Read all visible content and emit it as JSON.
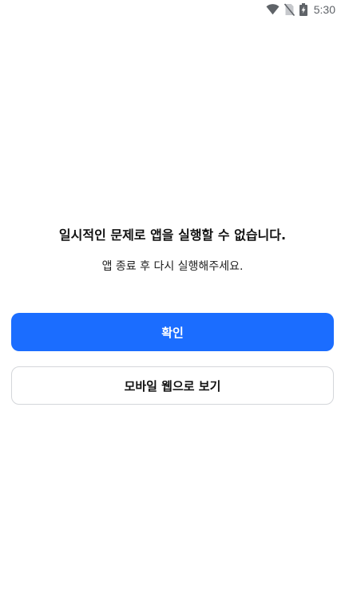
{
  "status_bar": {
    "time": "5:30",
    "icons": [
      "wifi-icon",
      "no-sim-icon",
      "battery-charging-icon"
    ]
  },
  "dialog": {
    "title": "일시적인 문제로 앱을 실행할 수 없습니다.",
    "message": "앱 종료 후 다시 실행해주세요."
  },
  "buttons": {
    "confirm_label": "확인",
    "mobile_web_label": "모바일 웹으로 보기"
  },
  "colors": {
    "primary": "#1b6dff",
    "secondary_border": "#d4d6da",
    "status_icon": "#5f6368"
  }
}
